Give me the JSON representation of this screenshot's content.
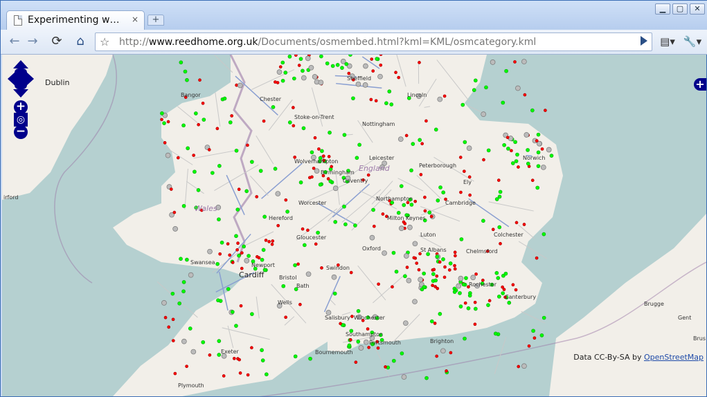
{
  "window": {
    "tab_title": "Experimenting w…",
    "tab_close": "×",
    "new_tab": "+",
    "minimize": "▁",
    "maximize": "▢",
    "close": "✕"
  },
  "toolbar": {
    "url_host": "www.reedhome.org.uk",
    "url_scheme": "http://",
    "url_path": "/Documents/osmembed.html?kml=KML/osmcategory.kml"
  },
  "map": {
    "places": [
      {
        "name": "Dublin",
        "big": true
      },
      {
        "name": "Wales",
        "region": true
      },
      {
        "name": "England",
        "region": true
      },
      {
        "name": "Bangor"
      },
      {
        "name": "Chester"
      },
      {
        "name": "Stoke-on-Trent"
      },
      {
        "name": "Nottingham"
      },
      {
        "name": "Sheffield"
      },
      {
        "name": "Lincoln"
      },
      {
        "name": "Wolverhampton"
      },
      {
        "name": "Birmingham"
      },
      {
        "name": "Coventry"
      },
      {
        "name": "Leicester"
      },
      {
        "name": "Peterborough"
      },
      {
        "name": "Norwich"
      },
      {
        "name": "Ely"
      },
      {
        "name": "Worcester"
      },
      {
        "name": "Northampton"
      },
      {
        "name": "Cambridge"
      },
      {
        "name": "Hereford"
      },
      {
        "name": "Milton Keynes"
      },
      {
        "name": "Gloucester"
      },
      {
        "name": "Oxford"
      },
      {
        "name": "Luton"
      },
      {
        "name": "St Albans"
      },
      {
        "name": "Colchester"
      },
      {
        "name": "Chelmsford"
      },
      {
        "name": "Swansea"
      },
      {
        "name": "Newport"
      },
      {
        "name": "Cardiff",
        "big": true
      },
      {
        "name": "Bristol"
      },
      {
        "name": "Swindon"
      },
      {
        "name": "Bath"
      },
      {
        "name": "Rochester"
      },
      {
        "name": "Canterbury"
      },
      {
        "name": "Wells"
      },
      {
        "name": "Salisbury"
      },
      {
        "name": "Winchester"
      },
      {
        "name": "Southampton"
      },
      {
        "name": "Portsmouth"
      },
      {
        "name": "Brighton"
      },
      {
        "name": "Bournemouth"
      },
      {
        "name": "Exeter"
      },
      {
        "name": "Plymouth"
      },
      {
        "name": "Brugge"
      },
      {
        "name": "Gent"
      },
      {
        "name": "Brus"
      },
      {
        "name": "irford"
      }
    ],
    "attribution_prefix": "Data CC-By-SA by ",
    "attribution_link": "OpenStreetMap",
    "zoom_in": "+",
    "zoom_out": "−",
    "layer_switcher": "+",
    "colors": {
      "water": "#b5d0d0",
      "land": "#f2efe9",
      "green_marker": "#00ff00",
      "red_marker": "#ff0000",
      "grey_marker": "#999999",
      "border": "#9b79a8"
    }
  }
}
